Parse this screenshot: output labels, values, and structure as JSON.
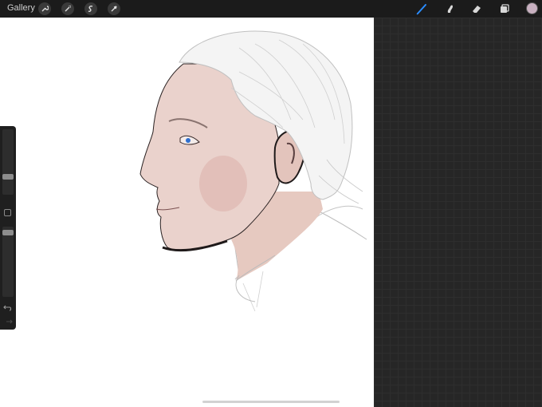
{
  "topbar": {
    "gallery_label": "Gallery",
    "left_tools": [
      "wrench-icon",
      "magic-wand-icon",
      "selection-icon",
      "transform-arrow-icon"
    ],
    "right_tools": [
      "brush-icon",
      "smudge-icon",
      "eraser-icon",
      "layers-icon"
    ],
    "active_tool": "brush-icon",
    "color": "#c8b0c0"
  },
  "sidebar": {
    "brush_size_level": 0.25,
    "opacity_level": 0.95
  },
  "colors": {
    "accent": "#2a8cff",
    "skin": "#e8cfc8"
  }
}
